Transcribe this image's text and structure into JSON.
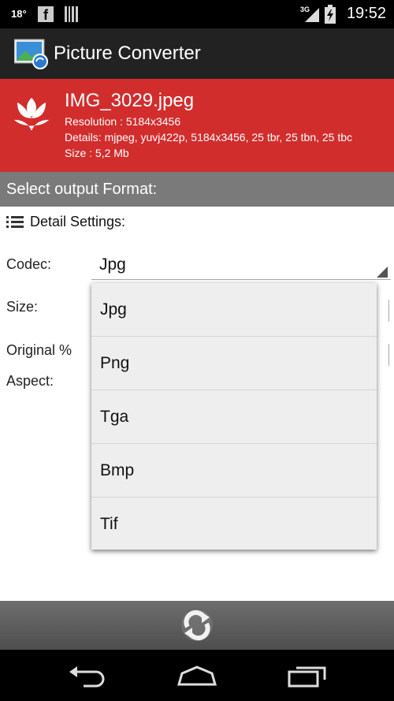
{
  "status_bar": {
    "temperature": "18°",
    "network": "3G",
    "time": "19:52"
  },
  "app": {
    "title": "Picture Converter"
  },
  "file_info": {
    "filename": "IMG_3029.jpeg",
    "resolution": "Resolution : 5184x3456",
    "details": "Details: mjpeg, yuvj422p, 5184x3456, 25 tbr, 25 tbn, 25 tbc",
    "size": "Size : 5,2 Mb"
  },
  "section": {
    "title": "Select output Format:"
  },
  "settings": {
    "header": "Detail Settings:",
    "codec_label": "Codec:",
    "size_label": "Size:",
    "original_label": "Original %",
    "aspect_label": "Aspect:",
    "codec_selected": "Jpg"
  },
  "codec_options": [
    "Jpg",
    "Png",
    "Tga",
    "Bmp",
    "Tif"
  ],
  "colors": {
    "info_panel": "#d22d2d",
    "section_header": "#7a7a7a",
    "action_bar": "#222222"
  },
  "icons": {
    "app": "picture-converter-icon",
    "file": "macro-flower-icon",
    "settings": "list-icon",
    "convert": "convert-arrows-icon",
    "nav": [
      "back-icon",
      "home-icon",
      "recents-icon"
    ]
  }
}
